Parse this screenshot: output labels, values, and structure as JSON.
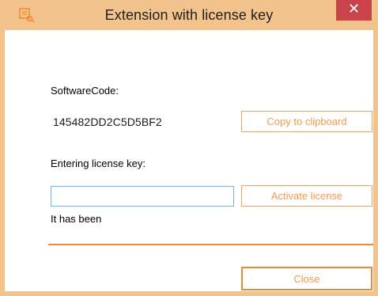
{
  "window": {
    "title": "Extension with license key",
    "close_glyph": "✕",
    "app_icon": "license-key-app-icon"
  },
  "software_code": {
    "label": "SoftwareCode:",
    "value": "145482DD2C5D5BF2",
    "copy_button": "Copy to clipboard"
  },
  "license": {
    "label": "Entering license key:",
    "input_value": "",
    "input_placeholder": "",
    "activate_button": "Activate license",
    "status_text": "It has been"
  },
  "footer": {
    "close_button": "Close"
  },
  "colors": {
    "accent": "#f08a35",
    "accent_text": "#f39a4c",
    "titlebar": "#f2c38d",
    "close_bg": "#c9434a",
    "input_border": "#6cb5e8"
  }
}
